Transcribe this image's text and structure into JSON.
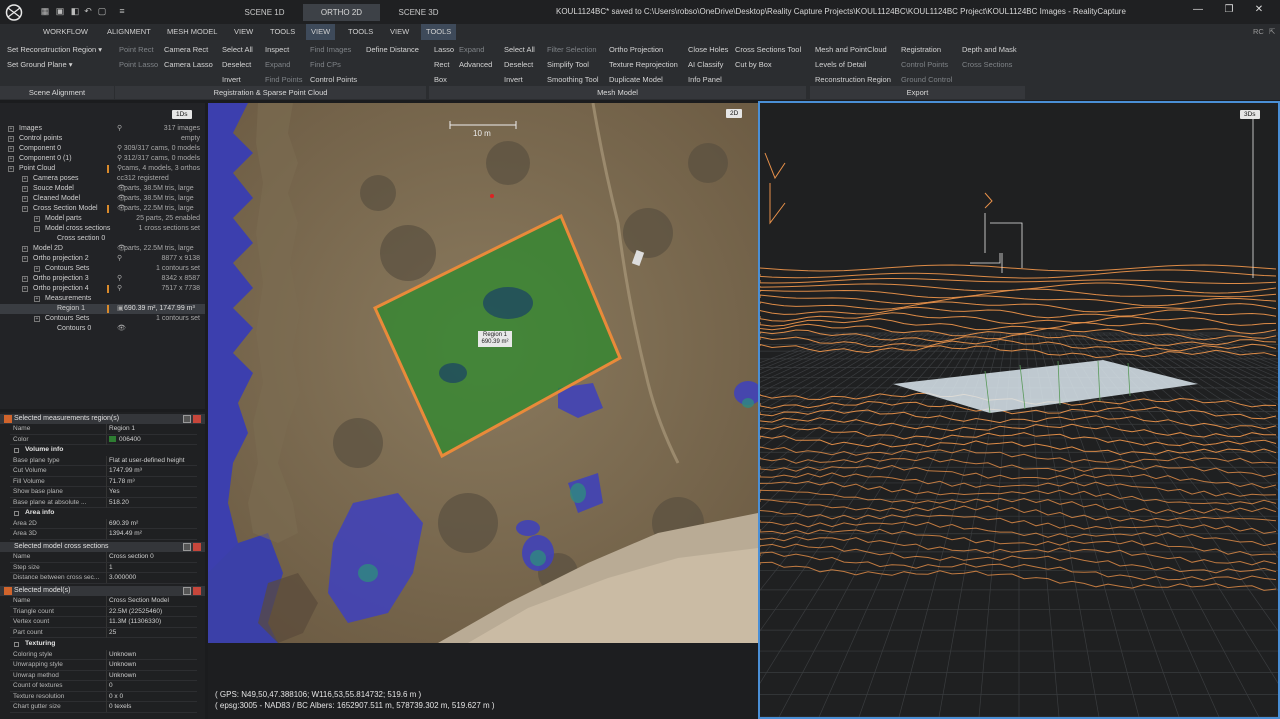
{
  "app": {
    "window_title": "KOUL1124BC* saved to  C:\\Users\\robso\\OneDrive\\Desktop\\Reality Capture Projects\\KOUL1124BC\\KOUL1124BC Project\\KOUL1124BC  Images - RealityCapture",
    "user": "RC"
  },
  "scene_tabs": [
    "SCENE 1D",
    "ORTHO 2D",
    "SCENE 3D"
  ],
  "menu": [
    "WORKFLOW",
    "ALIGNMENT",
    "MESH MODEL",
    "VIEW",
    "TOOLS",
    "VIEW",
    "TOOLS",
    "VIEW",
    "TOOLS"
  ],
  "ribbon": {
    "col1": [
      "Set Reconstruction Region",
      "Set Ground Plane"
    ],
    "col2": [
      "Point Rect",
      "Point Lasso"
    ],
    "col3": [
      "Camera Rect",
      "Camera Lasso"
    ],
    "col4": [
      "Select All",
      "Deselect",
      "Invert"
    ],
    "col5": [
      "Inspect",
      "Expand",
      "Find Points"
    ],
    "col6": [
      "Find Images",
      "Find CPs",
      "Control Points"
    ],
    "col7": [
      "Define Distance"
    ],
    "col8": [
      "Lasso",
      "Rect",
      "Box"
    ],
    "col9": [
      "Expand",
      "Advanced"
    ],
    "col10": [
      "Select All",
      "Deselect",
      "Invert"
    ],
    "col11": [
      "Filter Selection",
      "Simplify Tool",
      "Smoothing Tool"
    ],
    "col12": [
      "Ortho Projection",
      "Texture Reprojection",
      "Duplicate Model"
    ],
    "col13": [
      "Close Holes",
      "AI Classify",
      "Info Panel"
    ],
    "col14": [
      "Cross Sections Tool",
      "Cut by Box"
    ],
    "col15": [
      "Mesh and PointCloud",
      "Levels of Detail",
      "Reconstruction Region"
    ],
    "col16": [
      "Registration",
      "Control Points",
      "Ground Control"
    ],
    "col17": [
      "Depth and Mask",
      "Cross Sections"
    ],
    "groups": [
      "Scene Alignment",
      "Registration & Sparse Point Cloud",
      "Mesh Model",
      "Export"
    ]
  },
  "tree": {
    "badge": "1Ds",
    "rows": [
      {
        "label": "Images",
        "value": "317 images"
      },
      {
        "label": "Control points",
        "value": "empty"
      },
      {
        "label": "Component 0",
        "value": "309/317 cams, 0 models"
      },
      {
        "label": "Component 0 (1)",
        "value": "312/317 cams, 0 models"
      },
      {
        "label": "Point Cloud",
        "value": "cams, 4 models, 3 orthos"
      },
      {
        "label": "Camera poses",
        "value": "312 registered"
      },
      {
        "label": "Souce Model",
        "value": "parts, 38.5M tris, large"
      },
      {
        "label": "Cleaned Model",
        "value": "parts, 38.5M tris, large"
      },
      {
        "label": "Cross Section Model",
        "value": "parts, 22.5M tris, large"
      },
      {
        "label": "Model parts",
        "value": "25 parts, 25 enabled"
      },
      {
        "label": "Model cross sections",
        "value": "1 cross sections set"
      },
      {
        "label": "Cross section 0",
        "value": ""
      },
      {
        "label": "Model 2D",
        "value": "parts, 22.5M tris, large"
      },
      {
        "label": "Ortho projection 2",
        "value": "8877 x 9138"
      },
      {
        "label": "Contours Sets",
        "value": "1 contours set"
      },
      {
        "label": "Ortho projection 3",
        "value": "8342 x 8587"
      },
      {
        "label": "Ortho projection 4",
        "value": "7517 x 7738"
      },
      {
        "label": "Measurements",
        "value": ""
      },
      {
        "label": "Region 1",
        "value": "690.39 m², 1747.99 m³"
      },
      {
        "label": "Contours Sets",
        "value": "1 contours set"
      },
      {
        "label": "Contours 0",
        "value": ""
      }
    ]
  },
  "props": {
    "measure": {
      "title": "Selected measurements region(s)",
      "rows": [
        [
          "Name",
          "Region 1"
        ],
        [
          "Color",
          "006400"
        ]
      ],
      "volume_title": "Volume info",
      "volume": [
        [
          "Base plane type",
          "Flat at user-defined height"
        ],
        [
          "Cut Volume",
          "1747.99 m³"
        ],
        [
          "Fill Volume",
          "71.78 m³"
        ],
        [
          "Show base plane",
          "Yes"
        ],
        [
          "Base plane at absolute ...",
          "518.20"
        ]
      ],
      "area_title": "Area info",
      "area": [
        [
          "Area 2D",
          "690.39 m²"
        ],
        [
          "Area 3D",
          "1394.49 m²"
        ]
      ]
    },
    "cross": {
      "title": "Selected model cross sections",
      "rows": [
        [
          "Name",
          "Cross section 0"
        ],
        [
          "Step size",
          "1"
        ],
        [
          "Distance between cross sec...",
          "3.000000"
        ]
      ]
    },
    "model": {
      "title": "Selected model(s)",
      "rows": [
        [
          "Name",
          "Cross Section Model"
        ],
        [
          "Triangle count",
          "22.5M (22525460)"
        ],
        [
          "Vertex count",
          "11.3M (11306330)"
        ],
        [
          "Part count",
          "25"
        ]
      ],
      "tex_title": "Texturing",
      "tex": [
        [
          "Coloring style",
          "Unknown"
        ],
        [
          "Unwrapping style",
          "Unknown"
        ],
        [
          "Unwrap method",
          "Unknown"
        ],
        [
          "Count of textures",
          "0"
        ],
        [
          "Texture resolution",
          "0 x 0"
        ],
        [
          "Chart gutter size",
          "0 texels"
        ]
      ]
    }
  },
  "view2d": {
    "tag": "2D",
    "scale": "10 m",
    "region_label": "Region 1",
    "region_value": "690.39 m²",
    "gps1": "( GPS: N49,50,47.388106; W116,53,55.814732; 519.6 m )",
    "gps2": "( epsg:3005 - NAD83 / BC Albers: 1652907.511 m, 578739.302 m, 519.627 m )"
  },
  "view3d": {
    "tag": "3Ds"
  },
  "colors": {
    "region_fill": "#2e8a2e",
    "region_border": "#e98a3a",
    "contour": "#e8914a",
    "active_border": "#4a8fd6"
  }
}
